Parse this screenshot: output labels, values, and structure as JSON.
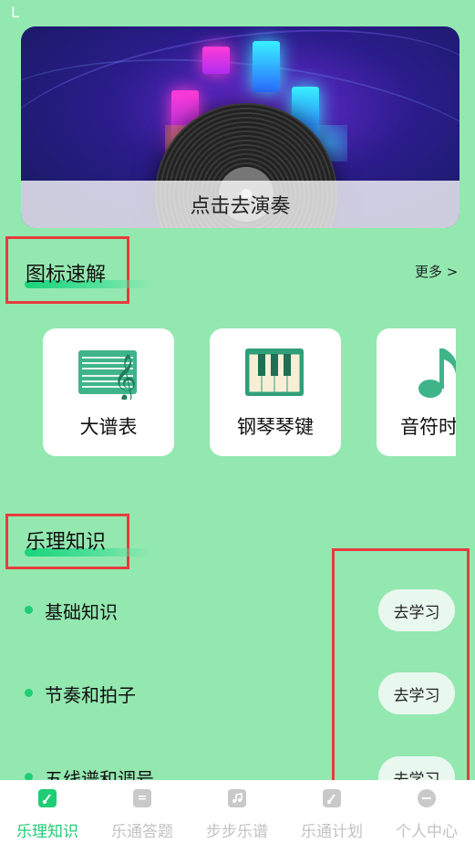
{
  "status": {
    "indicator": "L"
  },
  "banner": {
    "caption": "点击去演奏"
  },
  "icon_section": {
    "title": "图标速解",
    "more": "更多 >",
    "cards": [
      {
        "label": "大谱表",
        "icon": "grand-staff-icon"
      },
      {
        "label": "钢琴琴键",
        "icon": "piano-keys-icon"
      },
      {
        "label": "音符时",
        "icon": "music-note-icon"
      }
    ]
  },
  "theory_section": {
    "title": "乐理知识",
    "items": [
      {
        "label": "基础知识",
        "button": "去学习"
      },
      {
        "label": "节奏和拍子",
        "button": "去学习"
      },
      {
        "label": "五线谱和调号",
        "button": "去学习"
      }
    ]
  },
  "nav": {
    "items": [
      {
        "label": "乐理知识",
        "active": true
      },
      {
        "label": "乐通答题",
        "active": false
      },
      {
        "label": "步步乐谱",
        "active": false
      },
      {
        "label": "乐通计划",
        "active": false
      },
      {
        "label": "个人中心",
        "active": false
      }
    ]
  },
  "colors": {
    "background": "#93e8b0",
    "accent": "#1fcd74",
    "highlight_box": "#e53d3d"
  }
}
